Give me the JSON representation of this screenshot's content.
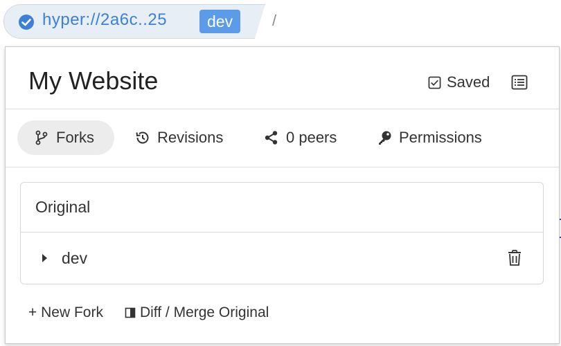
{
  "urlbar": {
    "url": "hyper://2a6c..25",
    "badge": "dev",
    "path": "/"
  },
  "panel": {
    "title": "My Website",
    "saved_label": "Saved",
    "tabs": [
      {
        "label": "Forks",
        "icon": "fork-icon",
        "active": true
      },
      {
        "label": "Revisions",
        "icon": "history-icon",
        "active": false
      },
      {
        "label": "0 peers",
        "icon": "share-icon",
        "active": false
      },
      {
        "label": "Permissions",
        "icon": "key-icon",
        "active": false
      }
    ],
    "forks": {
      "header": "Original",
      "items": [
        {
          "name": "dev"
        }
      ]
    },
    "footer": {
      "new_fork": "+ New Fork",
      "diff_merge": "Diff / Merge Original"
    }
  },
  "colors": {
    "accent": "#3d80d8",
    "badge_bg": "#5b9be8",
    "url_bg": "#e8eef6"
  }
}
